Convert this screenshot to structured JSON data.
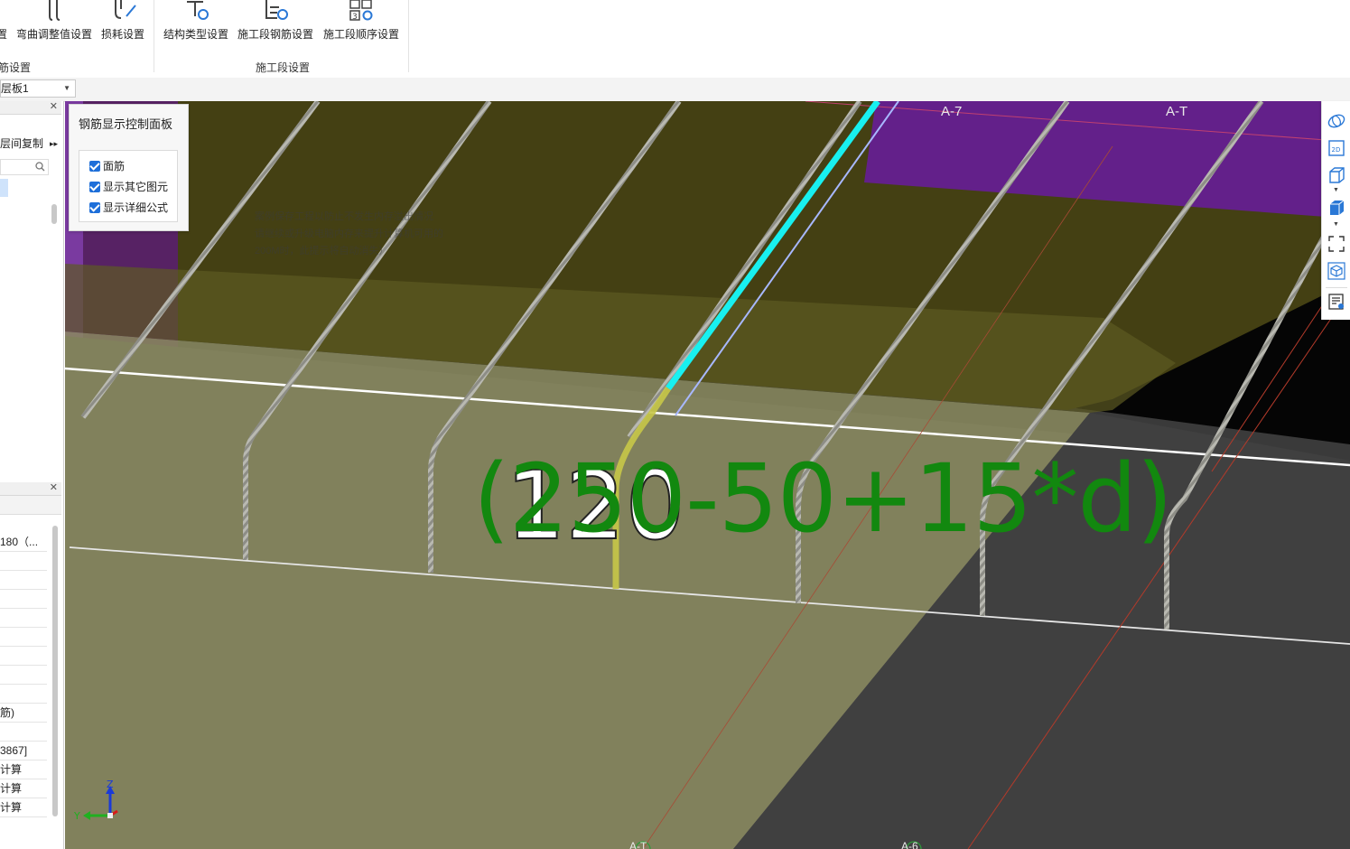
{
  "ribbon": {
    "buttons": [
      {
        "label": "置"
      },
      {
        "label": "弯曲调整值设置"
      },
      {
        "label": "损耗设置"
      },
      {
        "label": "结构类型设置"
      },
      {
        "label": "施工段钢筋设置"
      },
      {
        "label": "施工段顺序设置"
      }
    ],
    "groups": [
      {
        "label": "筋设置"
      },
      {
        "label": "施工段设置"
      }
    ]
  },
  "subbar": {
    "floor_select": "层板1"
  },
  "left_panel": {
    "top_action": "层间复制",
    "rows": [
      "180（...",
      "",
      "",
      "",
      "",
      "",
      "",
      "",
      "",
      "筋)",
      "",
      "3867]",
      "计算",
      "计算",
      "计算"
    ]
  },
  "control_panel": {
    "title": "钢筋显示控制面板",
    "options": [
      {
        "label": "面筋",
        "checked": true
      },
      {
        "label": "显示其它图元",
        "checked": true
      },
      {
        "label": "显示详细公式",
        "checked": true
      }
    ]
  },
  "viewport": {
    "warning_lines": [
      "案例保存工程以防止不发生内存溢出情况",
      "请继续或升级电脑内存来提升计算机可用的",
      "200M时，此提示将自动消失）"
    ],
    "axis_labels": [
      "A-7",
      "A-T",
      "A-T",
      "A-6"
    ],
    "formula": "(250-50+15*d)",
    "dim_value": "120",
    "triad": {
      "z": "Z",
      "y": "Y"
    }
  },
  "right_toolbar": [
    "ellipse-view-icon",
    "2d-icon",
    "cube-outline-icon",
    "solid-cube-icon",
    "fit-view-icon",
    "hexagon-cube-icon",
    "report-icon"
  ],
  "colors": {
    "formula": "#12880f",
    "cyan_rebar": "#18f0f0",
    "purple": "#6a1f8a",
    "olive": "#43401a",
    "checkbox": "#1e6fd9"
  }
}
